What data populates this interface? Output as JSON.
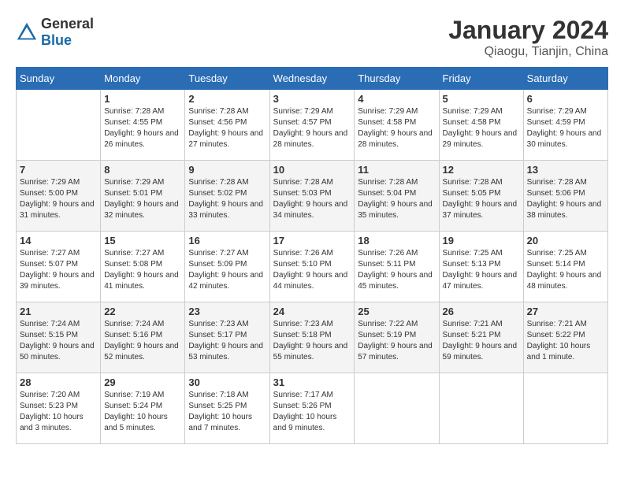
{
  "header": {
    "logo_general": "General",
    "logo_blue": "Blue",
    "month": "January 2024",
    "location": "Qiaogu, Tianjin, China"
  },
  "days_of_week": [
    "Sunday",
    "Monday",
    "Tuesday",
    "Wednesday",
    "Thursday",
    "Friday",
    "Saturday"
  ],
  "weeks": [
    [
      {
        "day": "",
        "sunrise": "",
        "sunset": "",
        "daylight": ""
      },
      {
        "day": "1",
        "sunrise": "7:28 AM",
        "sunset": "4:55 PM",
        "daylight": "9 hours and 26 minutes."
      },
      {
        "day": "2",
        "sunrise": "7:28 AM",
        "sunset": "4:56 PM",
        "daylight": "9 hours and 27 minutes."
      },
      {
        "day": "3",
        "sunrise": "7:29 AM",
        "sunset": "4:57 PM",
        "daylight": "9 hours and 28 minutes."
      },
      {
        "day": "4",
        "sunrise": "7:29 AM",
        "sunset": "4:58 PM",
        "daylight": "9 hours and 28 minutes."
      },
      {
        "day": "5",
        "sunrise": "7:29 AM",
        "sunset": "4:58 PM",
        "daylight": "9 hours and 29 minutes."
      },
      {
        "day": "6",
        "sunrise": "7:29 AM",
        "sunset": "4:59 PM",
        "daylight": "9 hours and 30 minutes."
      }
    ],
    [
      {
        "day": "7",
        "sunrise": "7:29 AM",
        "sunset": "5:00 PM",
        "daylight": "9 hours and 31 minutes."
      },
      {
        "day": "8",
        "sunrise": "7:29 AM",
        "sunset": "5:01 PM",
        "daylight": "9 hours and 32 minutes."
      },
      {
        "day": "9",
        "sunrise": "7:28 AM",
        "sunset": "5:02 PM",
        "daylight": "9 hours and 33 minutes."
      },
      {
        "day": "10",
        "sunrise": "7:28 AM",
        "sunset": "5:03 PM",
        "daylight": "9 hours and 34 minutes."
      },
      {
        "day": "11",
        "sunrise": "7:28 AM",
        "sunset": "5:04 PM",
        "daylight": "9 hours and 35 minutes."
      },
      {
        "day": "12",
        "sunrise": "7:28 AM",
        "sunset": "5:05 PM",
        "daylight": "9 hours and 37 minutes."
      },
      {
        "day": "13",
        "sunrise": "7:28 AM",
        "sunset": "5:06 PM",
        "daylight": "9 hours and 38 minutes."
      }
    ],
    [
      {
        "day": "14",
        "sunrise": "7:27 AM",
        "sunset": "5:07 PM",
        "daylight": "9 hours and 39 minutes."
      },
      {
        "day": "15",
        "sunrise": "7:27 AM",
        "sunset": "5:08 PM",
        "daylight": "9 hours and 41 minutes."
      },
      {
        "day": "16",
        "sunrise": "7:27 AM",
        "sunset": "5:09 PM",
        "daylight": "9 hours and 42 minutes."
      },
      {
        "day": "17",
        "sunrise": "7:26 AM",
        "sunset": "5:10 PM",
        "daylight": "9 hours and 44 minutes."
      },
      {
        "day": "18",
        "sunrise": "7:26 AM",
        "sunset": "5:11 PM",
        "daylight": "9 hours and 45 minutes."
      },
      {
        "day": "19",
        "sunrise": "7:25 AM",
        "sunset": "5:13 PM",
        "daylight": "9 hours and 47 minutes."
      },
      {
        "day": "20",
        "sunrise": "7:25 AM",
        "sunset": "5:14 PM",
        "daylight": "9 hours and 48 minutes."
      }
    ],
    [
      {
        "day": "21",
        "sunrise": "7:24 AM",
        "sunset": "5:15 PM",
        "daylight": "9 hours and 50 minutes."
      },
      {
        "day": "22",
        "sunrise": "7:24 AM",
        "sunset": "5:16 PM",
        "daylight": "9 hours and 52 minutes."
      },
      {
        "day": "23",
        "sunrise": "7:23 AM",
        "sunset": "5:17 PM",
        "daylight": "9 hours and 53 minutes."
      },
      {
        "day": "24",
        "sunrise": "7:23 AM",
        "sunset": "5:18 PM",
        "daylight": "9 hours and 55 minutes."
      },
      {
        "day": "25",
        "sunrise": "7:22 AM",
        "sunset": "5:19 PM",
        "daylight": "9 hours and 57 minutes."
      },
      {
        "day": "26",
        "sunrise": "7:21 AM",
        "sunset": "5:21 PM",
        "daylight": "9 hours and 59 minutes."
      },
      {
        "day": "27",
        "sunrise": "7:21 AM",
        "sunset": "5:22 PM",
        "daylight": "10 hours and 1 minute."
      }
    ],
    [
      {
        "day": "28",
        "sunrise": "7:20 AM",
        "sunset": "5:23 PM",
        "daylight": "10 hours and 3 minutes."
      },
      {
        "day": "29",
        "sunrise": "7:19 AM",
        "sunset": "5:24 PM",
        "daylight": "10 hours and 5 minutes."
      },
      {
        "day": "30",
        "sunrise": "7:18 AM",
        "sunset": "5:25 PM",
        "daylight": "10 hours and 7 minutes."
      },
      {
        "day": "31",
        "sunrise": "7:17 AM",
        "sunset": "5:26 PM",
        "daylight": "10 hours and 9 minutes."
      },
      {
        "day": "",
        "sunrise": "",
        "sunset": "",
        "daylight": ""
      },
      {
        "day": "",
        "sunrise": "",
        "sunset": "",
        "daylight": ""
      },
      {
        "day": "",
        "sunrise": "",
        "sunset": "",
        "daylight": ""
      }
    ]
  ]
}
